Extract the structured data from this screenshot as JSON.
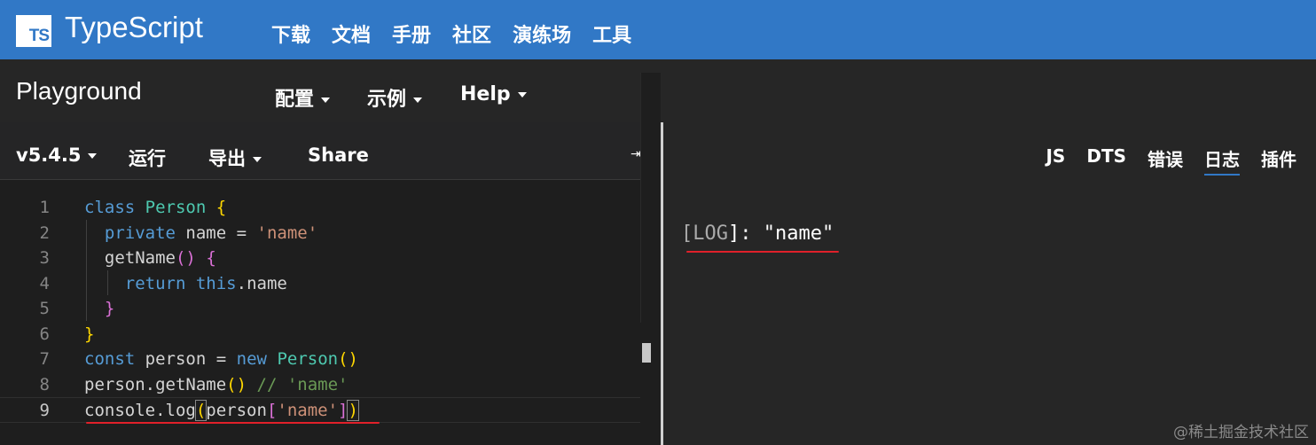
{
  "topbar": {
    "logo_text": "TS",
    "brand": "TypeScript",
    "nav": [
      "下载",
      "文档",
      "手册",
      "社区",
      "演练场",
      "工具"
    ],
    "bg_color": "#3178c6"
  },
  "playground_bar": {
    "title": "Playground",
    "menus": [
      {
        "label": "配置",
        "icon": "caret-down-icon"
      },
      {
        "label": "示例",
        "icon": "caret-down-icon"
      },
      {
        "label": "Help",
        "icon": "caret-down-icon"
      }
    ]
  },
  "editor_toolbar": {
    "version": "v5.4.5",
    "run": "运行",
    "export": "导出",
    "share": "Share",
    "collapse_icon": "⇥"
  },
  "editor": {
    "line_numbers": [
      "1",
      "2",
      "3",
      "4",
      "5",
      "6",
      "7",
      "8",
      "9"
    ],
    "active_line": 9,
    "code": {
      "l1": {
        "kw": "class",
        "name": "Person",
        "brace": "{"
      },
      "l2": {
        "kw": "private",
        "name": "name",
        "op": "=",
        "str": "'name'"
      },
      "l3": {
        "fn": "getName",
        "parens": "()",
        "brace": "{"
      },
      "l4": {
        "kw": "return",
        "this": "this",
        "prop": ".name"
      },
      "l5": {
        "brace": "}"
      },
      "l6": {
        "brace": "}"
      },
      "l7": {
        "kw": "const",
        "name": "person",
        "op": "=",
        "new": "new",
        "cls": "Person",
        "parens": "()"
      },
      "l8": {
        "obj": "person.getName",
        "parens": "()",
        "comment": "// 'name'"
      },
      "l9": {
        "obj": "console.log",
        "open": "(",
        "person": "person",
        "lb": "[",
        "str": "'name'",
        "rb": "]",
        "close": ")"
      }
    }
  },
  "output": {
    "tabs": [
      {
        "label": "JS",
        "active": false
      },
      {
        "label": "DTS",
        "active": false
      },
      {
        "label": "错误",
        "active": false
      },
      {
        "label": "日志",
        "active": true
      },
      {
        "label": "插件",
        "active": false
      }
    ],
    "log": {
      "open": "[",
      "level": "LOG",
      "close": "]:",
      "value": "\"name\""
    }
  },
  "watermark": "@稀土掘金技术社区"
}
